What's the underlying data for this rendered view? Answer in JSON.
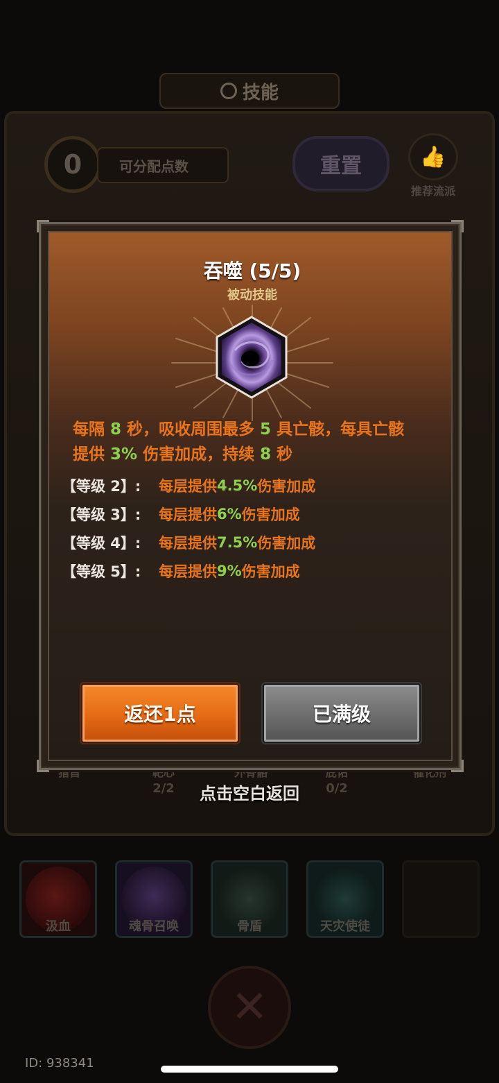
{
  "background": {
    "title": "技能",
    "points_value": "0",
    "points_label": "可分配点数",
    "reset_label": "重置",
    "recommend_label": "推荐流派",
    "row_labels": [
      "猎首",
      "靶心",
      "外骨骼",
      "庇佑",
      "催化剂"
    ],
    "row_counts": [
      "2/2",
      "0/2"
    ],
    "tap_hint": "点击空白返回",
    "bottom_skills": [
      "汲血",
      "魂骨召唤",
      "骨盾",
      "天灾使徒"
    ],
    "user_id": "ID: 938341"
  },
  "dialog": {
    "title": "吞噬 (5/5)",
    "type": "被动技能",
    "icon": "black-hole-icon",
    "description": {
      "line1": [
        "每隔 ",
        "8",
        " 秒，吸收周围最多 ",
        "5",
        " 具亡骸，每具亡骸"
      ],
      "line2": [
        "提供 ",
        "3%",
        " 伤害加成，持续 ",
        "8",
        " 秒"
      ]
    },
    "levels": [
      {
        "label": "【等级 2】:",
        "prefix": "每层提供 ",
        "value": "4.5%",
        "suffix": " 伤害加成"
      },
      {
        "label": "【等级 3】:",
        "prefix": "每层提供 ",
        "value": "6%",
        "suffix": " 伤害加成"
      },
      {
        "label": "【等级 4】:",
        "prefix": "每层提供 ",
        "value": "7.5%",
        "suffix": " 伤害加成"
      },
      {
        "label": "【等级 5】:",
        "prefix": "每层提供 ",
        "value": "9%",
        "suffix": " 伤害加成"
      }
    ],
    "refund_label": "返还1点",
    "maxed_label": "已满级"
  },
  "colors": {
    "accent_orange": "#e8741c",
    "value_green": "#8fd14f",
    "type_gold": "#e2c88a"
  }
}
